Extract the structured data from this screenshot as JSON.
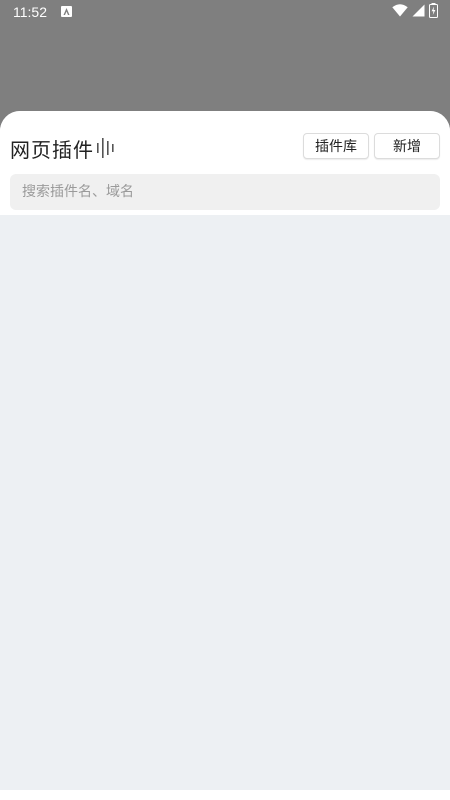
{
  "status_bar": {
    "time": "11:52",
    "app_icon": "android-app-icon",
    "icons": [
      "wifi-icon",
      "cell-signal-icon",
      "battery-icon"
    ]
  },
  "sheet": {
    "title": "网页插件",
    "title_icon": "voice-wave-icon",
    "buttons": {
      "library_label": "插件库",
      "add_label": "新增"
    },
    "search": {
      "placeholder": "搜索插件名、域名",
      "value": ""
    }
  },
  "colors": {
    "scrim": "#7f7f7f",
    "sheet_background": "#edf0f3",
    "header_background": "#ffffff",
    "search_background": "#f0f0f0"
  }
}
